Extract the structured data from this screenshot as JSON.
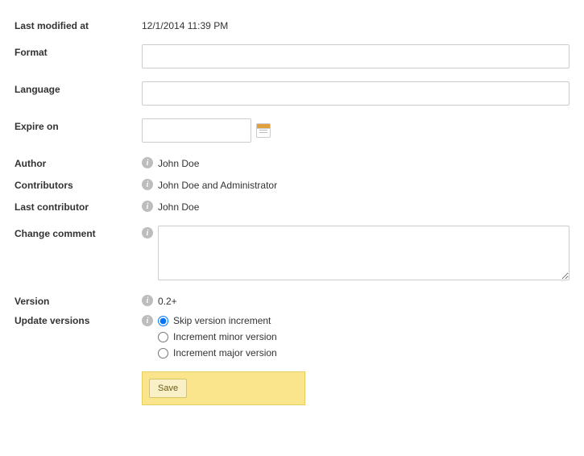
{
  "lastModifiedAt": {
    "label": "Last modified at",
    "value": "12/1/2014 11:39 PM"
  },
  "format": {
    "label": "Format",
    "value": ""
  },
  "language": {
    "label": "Language",
    "value": ""
  },
  "expireOn": {
    "label": "Expire on",
    "value": ""
  },
  "author": {
    "label": "Author",
    "value": "John Doe"
  },
  "contributors": {
    "label": "Contributors",
    "value": "John Doe and Administrator"
  },
  "lastContributor": {
    "label": "Last contributor",
    "value": "John Doe"
  },
  "changeComment": {
    "label": "Change comment",
    "value": ""
  },
  "version": {
    "label": "Version",
    "value": "0.2+"
  },
  "updateVersions": {
    "label": "Update versions",
    "options": [
      {
        "label": "Skip version increment",
        "selected": true
      },
      {
        "label": "Increment minor version",
        "selected": false
      },
      {
        "label": "Increment major version",
        "selected": false
      }
    ]
  },
  "saveLabel": "Save"
}
